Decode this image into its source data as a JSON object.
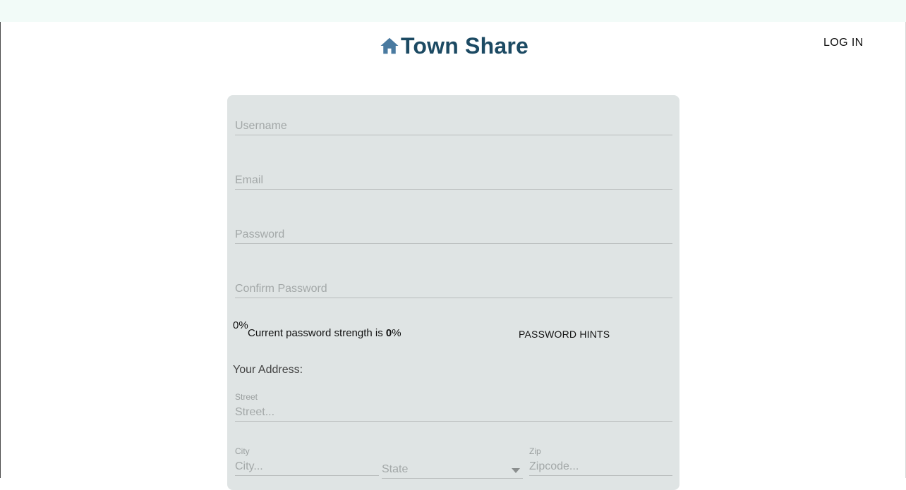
{
  "app": {
    "title": "Town Share",
    "logo_icon": "home-icon"
  },
  "nav": {
    "login_label": "LOG IN"
  },
  "form": {
    "username": {
      "placeholder": "Username",
      "value": ""
    },
    "email": {
      "placeholder": "Email",
      "value": ""
    },
    "password": {
      "placeholder": "Password",
      "value": ""
    },
    "confirm_password": {
      "placeholder": "Confirm Password",
      "value": ""
    },
    "strength": {
      "percent_display": "0%",
      "text_prefix": "Current password strength is ",
      "value": "0",
      "text_suffix": "%"
    },
    "hints_label": "PASSWORD HINTS",
    "address": {
      "heading": "Your Address:",
      "street": {
        "label": "Street",
        "placeholder": "Street..."
      },
      "city": {
        "label": "City",
        "placeholder": "City..."
      },
      "state": {
        "placeholder": "State"
      },
      "zip": {
        "label": "Zip",
        "placeholder": "Zipcode..."
      }
    }
  },
  "colors": {
    "brand": "#1c4a63",
    "icon": "#4a7aa0",
    "card": "#dfe4e4",
    "topbar": "#f2fbf8"
  }
}
